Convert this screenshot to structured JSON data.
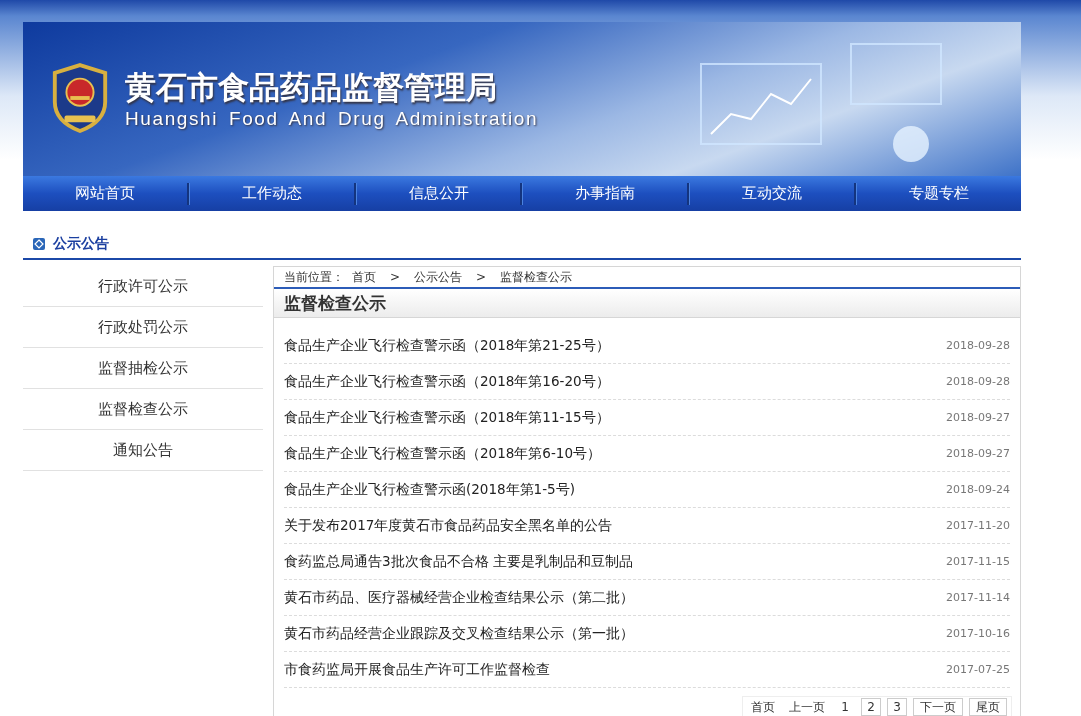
{
  "header": {
    "title_cn": "黄石市食品药品监督管理局",
    "title_en": "Huangshi Food And Drug Administration"
  },
  "nav": [
    {
      "label": "网站首页"
    },
    {
      "label": "工作动态"
    },
    {
      "label": "信息公开"
    },
    {
      "label": "办事指南"
    },
    {
      "label": "互动交流"
    },
    {
      "label": "专题专栏"
    }
  ],
  "section": {
    "title": "公示公告"
  },
  "sidebar": {
    "items": [
      {
        "label": "行政许可公示",
        "selected": false
      },
      {
        "label": "行政处罚公示",
        "selected": false
      },
      {
        "label": "监督抽检公示",
        "selected": false
      },
      {
        "label": "监督检查公示",
        "selected": false
      },
      {
        "label": "通知公告",
        "selected": false
      }
    ]
  },
  "breadcrumb": {
    "label": "当前位置：",
    "items": [
      {
        "text": "首页"
      },
      {
        "text": "公示公告"
      },
      {
        "text": "监督检查公示"
      }
    ],
    "separator": ">"
  },
  "content": {
    "title": "监督检查公示",
    "rows": [
      {
        "title": "食品生产企业飞行检查警示函（2018年第21-25号）",
        "date": "2018-09-28"
      },
      {
        "title": "食品生产企业飞行检查警示函（2018年第16-20号）",
        "date": "2018-09-28"
      },
      {
        "title": "食品生产企业飞行检查警示函（2018年第11-15号）",
        "date": "2018-09-27"
      },
      {
        "title": "食品生产企业飞行检查警示函（2018年第6-10号）",
        "date": "2018-09-27"
      },
      {
        "title": "食品生产企业飞行检查警示函(2018年第1-5号)",
        "date": "2018-09-24"
      },
      {
        "title": "关于发布2017年度黄石市食品药品安全黑名单的公告",
        "date": "2017-11-20"
      },
      {
        "title": "食药监总局通告3批次食品不合格 主要是乳制品和豆制品",
        "date": "2017-11-15"
      },
      {
        "title": "黄石市药品、医疗器械经营企业检查结果公示（第二批）",
        "date": "2017-11-14"
      },
      {
        "title": "黄石市药品经营企业跟踪及交叉检查结果公示（第一批）",
        "date": "2017-10-16"
      },
      {
        "title": "市食药监局开展食品生产许可工作监督检查",
        "date": "2017-07-25"
      }
    ]
  },
  "pagination": {
    "first": "首页",
    "prev": "上一页",
    "pages": [
      {
        "label": "1",
        "selected": true
      },
      {
        "label": "2",
        "selected": false
      },
      {
        "label": "3",
        "selected": false
      }
    ],
    "next": "下一页",
    "last": "尾页"
  }
}
